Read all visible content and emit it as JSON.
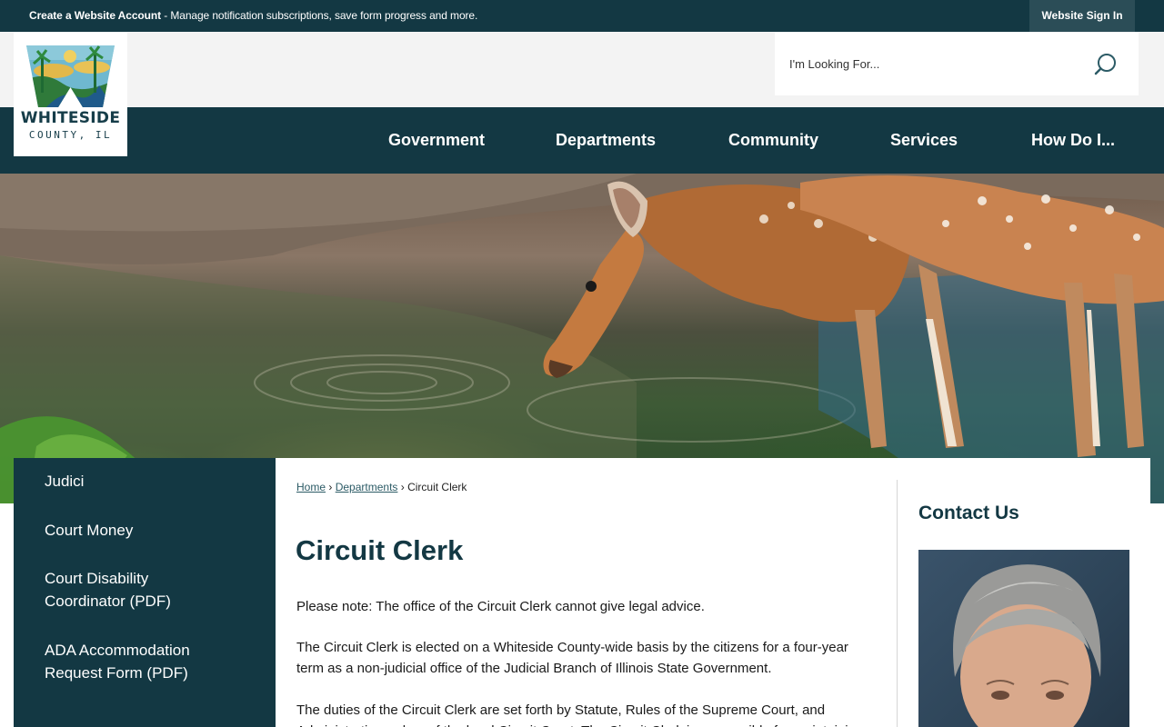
{
  "topbar": {
    "account_strong": "Create a Website Account",
    "account_rest": " - Manage notification subscriptions, save form progress and more.",
    "signin": "Website Sign In"
  },
  "logo": {
    "title": "WHITESIDE",
    "subtitle": "COUNTY, IL"
  },
  "search": {
    "placeholder": "I'm Looking For..."
  },
  "nav": {
    "items": [
      "Government",
      "Departments",
      "Community",
      "Services",
      "How Do I..."
    ]
  },
  "sidebar": {
    "items": [
      {
        "label": "Judici"
      },
      {
        "label": "Court Money"
      },
      {
        "label": "Court Disability Coordinator (PDF)"
      },
      {
        "label": "ADA Accommodation Request Form (PDF)"
      }
    ]
  },
  "breadcrumb": {
    "home": "Home",
    "sep": "›",
    "departments": "Departments",
    "current": "Circuit Clerk"
  },
  "main": {
    "title": "Circuit Clerk",
    "p1": "Please note: The office of the Circuit Clerk cannot give legal advice.",
    "p2": "The Circuit Clerk is elected on a Whiteside County-wide basis by the citizens for a four-year term as a non-judicial office of the Judicial Branch of Illinois State Government.",
    "p3": "The duties of the Circuit Clerk are set forth by Statute, Rules of the Supreme Court, and Administrative orders of the local Circuit Court. The Circuit Clerk is responsible for maintaining"
  },
  "contact": {
    "title": "Contact Us"
  },
  "colors": {
    "brand_dark": "#133843",
    "signin_bg": "#2b4d57",
    "link": "#2c5b66"
  },
  "icons": {
    "search": "search-icon",
    "logo": "whiteside-county-logo",
    "photo": "clerk-portrait"
  }
}
